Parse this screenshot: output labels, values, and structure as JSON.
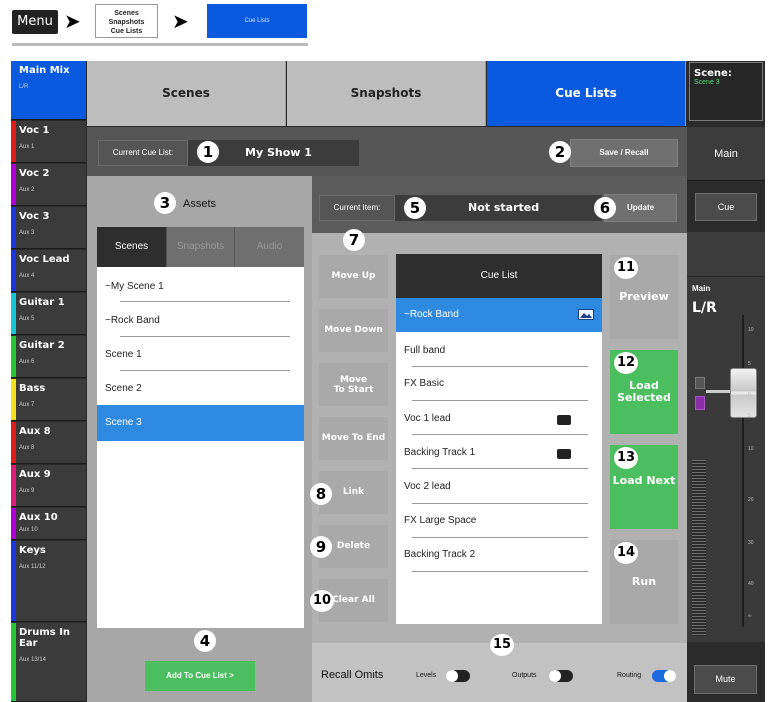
{
  "breadcrumb": {
    "menu": "Menu",
    "arrow": "➤",
    "submenu_box": "Scenes\nSnapshots\nCue Lists",
    "current": "Cue Lists"
  },
  "channels": [
    {
      "name": "Main Mix",
      "sub": "L/R",
      "color": "#0a5ae0"
    },
    {
      "name": "Voc 1",
      "sub": "Aux 1",
      "color": "#e01b1b"
    },
    {
      "name": "Voc 2",
      "sub": "Aux 2",
      "color": "#b000d8"
    },
    {
      "name": "Voc 3",
      "sub": "Aux 3",
      "color": "#1a36e0"
    },
    {
      "name": "Voc Lead",
      "sub": "Aux 4",
      "color": "#1a36e0"
    },
    {
      "name": "Guitar 1",
      "sub": "Aux 5",
      "color": "#17c7d8"
    },
    {
      "name": "Guitar 2",
      "sub": "Aux 6",
      "color": "#25c734"
    },
    {
      "name": "Bass",
      "sub": "Aux 7",
      "color": "#f2e21b"
    },
    {
      "name": "Aux 8",
      "sub": "Aux 8",
      "color": "#e01b1b"
    },
    {
      "name": "Aux 9",
      "sub": "Aux 9",
      "color": "#e01b7a"
    },
    {
      "name": "Aux 10",
      "sub": "Aux 10",
      "color": "#b000d8"
    },
    {
      "name": "Keys",
      "sub": "Aux 11/12",
      "color": "#1a36e0"
    },
    {
      "name": "Drums In Ear",
      "sub": "Aux 13/14",
      "color": "#25c734"
    }
  ],
  "tabs": [
    "Scenes",
    "Snapshots",
    "Cue Lists"
  ],
  "header": {
    "current_cue_list_label": "Current Cue List:",
    "current_cue_list_value": "My Show 1",
    "save_recall": "Save / Recall"
  },
  "assets": {
    "title": "Assets",
    "tabs": [
      "Scenes",
      "Snapshots",
      "Audio"
    ],
    "items": [
      "~My Scene 1",
      "~Rock Band",
      "Scene 1",
      "Scene 2",
      "Scene 3"
    ],
    "add_button": "Add To Cue List >"
  },
  "current_item": {
    "label": "Current Item:",
    "value": "Not started",
    "update": "Update"
  },
  "actions": {
    "move_up": "Move Up",
    "move_down": "Move Down",
    "move_to_start": "Move To Start",
    "move_to_end": "Move To End",
    "link": "Link",
    "delete": "Delete",
    "clear_all": "Clear All"
  },
  "cue_list": {
    "title": "Cue List",
    "items": [
      "~Rock Band",
      "Full band",
      "FX Basic",
      "Voc 1 lead",
      "Backing Track 1",
      "Voc 2 lead",
      "FX Large Space",
      "Backing Track 2"
    ]
  },
  "right_buttons": {
    "preview": "Preview",
    "load_selected": "Load Selected",
    "load_next": "Load Next",
    "run": "Run"
  },
  "recall_omits": {
    "label": "Recall Omits",
    "levels": "Levels",
    "outputs": "Outputs",
    "routing": "Routing"
  },
  "right_panel": {
    "scene_label": "Scene:",
    "scene_value": "Scene 3",
    "main": "Main",
    "cue": "Cue",
    "fader_title": "Main",
    "fader_sub": "L/R",
    "scale": [
      "10",
      "5",
      "0",
      "5",
      "10",
      "20",
      "30",
      "40",
      "∞"
    ],
    "mute": "Mute"
  },
  "numbers": [
    "1",
    "2",
    "3",
    "4",
    "5",
    "6",
    "7",
    "8",
    "9",
    "10",
    "11",
    "12",
    "13",
    "14",
    "15"
  ]
}
